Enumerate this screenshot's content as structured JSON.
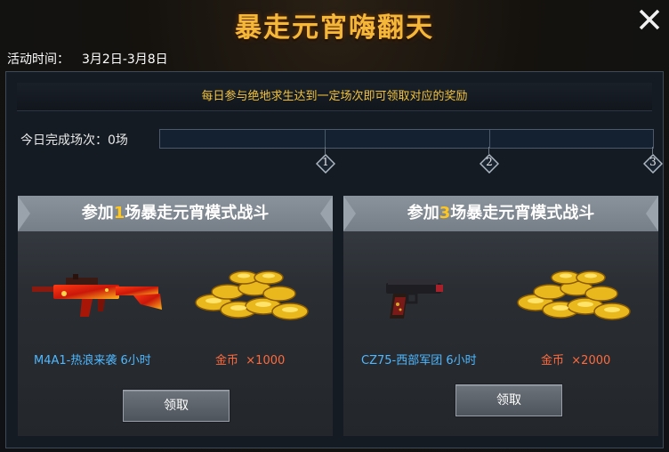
{
  "header": {
    "title": "暴走元宵嗨翻天",
    "close_label": "X",
    "period_label": "活动时间：",
    "period_value": "3月2日-3月8日"
  },
  "hint": "每日参与绝地求生达到一定场次即可领取对应的奖励",
  "progress": {
    "label": "今日完成场次：0场",
    "completed": 0,
    "milestones": [
      "1",
      "2",
      "3"
    ]
  },
  "cards": [
    {
      "title_prefix": "参加",
      "title_count": "1",
      "title_suffix": "场暴走元宵模式战斗",
      "item_icon": "rifle-icon",
      "item_label": "M4A1-热浪来袭 6小时",
      "coin_icon": "gold-coins-icon",
      "coin_label": "金币",
      "coin_amount": "×1000",
      "claim_label": "领取"
    },
    {
      "title_prefix": "参加",
      "title_count": "3",
      "title_suffix": "场暴走元宵模式战斗",
      "item_icon": "pistol-icon",
      "item_label": "CZ75-西部军团 6小时",
      "coin_icon": "gold-coins-icon",
      "coin_label": "金币",
      "coin_amount": "×2000",
      "claim_label": "领取"
    }
  ],
  "colors": {
    "title": "#f5b73a",
    "hint": "#f2c23a",
    "highlight": "#ffc61e",
    "item_label": "#4fb8ff",
    "coin_label": "#ff6a3d"
  }
}
